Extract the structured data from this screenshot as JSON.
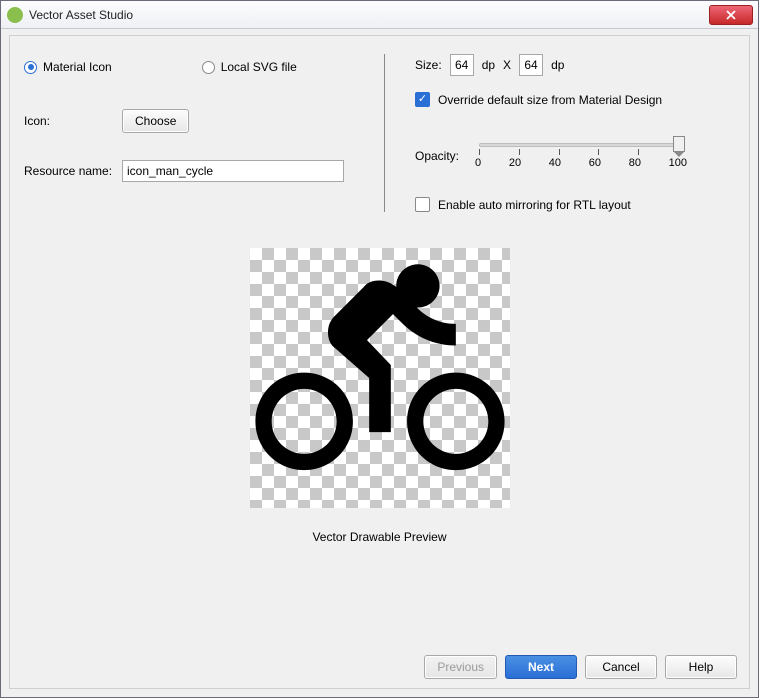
{
  "window": {
    "title": "Vector Asset Studio"
  },
  "assetType": {
    "options": [
      "Material Icon",
      "Local SVG file"
    ],
    "selectedIndex": 0
  },
  "iconRow": {
    "label": "Icon:",
    "button": "Choose"
  },
  "resourceRow": {
    "label": "Resource name:",
    "value": "icon_man_cycle"
  },
  "sizeRow": {
    "label": "Size:",
    "width": "64",
    "height": "64",
    "unit": "dp",
    "sep": "X"
  },
  "overrideSize": {
    "label": "Override default size from Material Design",
    "checked": true
  },
  "opacityRow": {
    "label": "Opacity:",
    "value": 100,
    "ticks": [
      "0",
      "20",
      "40",
      "60",
      "80",
      "100"
    ]
  },
  "rtlMirror": {
    "label": "Enable auto mirroring for RTL layout",
    "checked": false
  },
  "preview": {
    "label": "Vector Drawable Preview",
    "iconName": "directions-bike-icon"
  },
  "footer": {
    "previous": "Previous",
    "next": "Next",
    "cancel": "Cancel",
    "help": "Help"
  }
}
